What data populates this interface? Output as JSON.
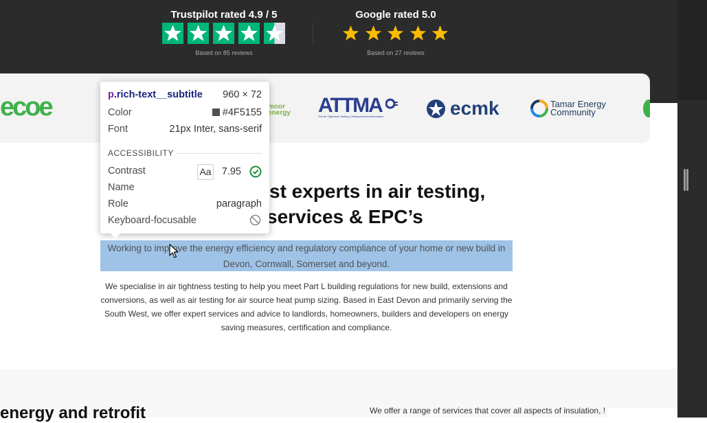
{
  "ratings": {
    "trustpilot": {
      "title": "Trustpilot rated 4.9 / 5",
      "sub": "Based on 85 reviews",
      "stars": 4.5
    },
    "google": {
      "title": "Google rated 5.0",
      "sub": "Based on 27 reviews",
      "stars": 5
    }
  },
  "logos": {
    "ecoe": "ecoe",
    "moor_line1": "moor",
    "moor_line2": "energy",
    "attma": "ATTMA",
    "attma_sub": "The Air Tightness Testing & Measurement Association",
    "ecmk": "ecmk",
    "tamar_line1": "Tamar Energy",
    "tamar_line2": "Community"
  },
  "main": {
    "heading_line1": "st experts in air testing,",
    "heading_line2": "services & EPC’s",
    "subtitle": "Working to improve the energy efficiency and regulatory compliance of your home or new build in Devon, Cornwall, Somerset and beyond.",
    "paragraph": "We specialise in air tightness testing to help you meet Part L building regulations for new build, extensions and conversions, as well as air testing for air source heat pump sizing. Based in East Devon and primarily serving the South West, we offer expert services and advice to landlords, homeowners, builders and developers on energy saving measures, certification and compliance."
  },
  "lower": {
    "left_heading": "energy and retrofit",
    "right_text": "We offer a range of services that cover all aspects of insulation, !"
  },
  "inspector": {
    "selector_tag": "p",
    "selector_class": ".rich-text__subtitle",
    "dimensions": "960 × 72",
    "color_label": "Color",
    "color_value": "#4F5155",
    "font_label": "Font",
    "font_value": "21px Inter, sans-serif",
    "section": "ACCESSIBILITY",
    "contrast_label": "Contrast",
    "contrast_sample": "Aa",
    "contrast_value": "7.95",
    "name_label": "Name",
    "role_label": "Role",
    "role_value": "paragraph",
    "keyboard_label": "Keyboard-focusable"
  },
  "colors": {
    "trustpilot_green": "#00b67a",
    "google_star": "#fbbc04",
    "highlight": "#9fc3e6",
    "subtitle_text": "#4F5155",
    "dark_band": "#2b2b2b"
  }
}
